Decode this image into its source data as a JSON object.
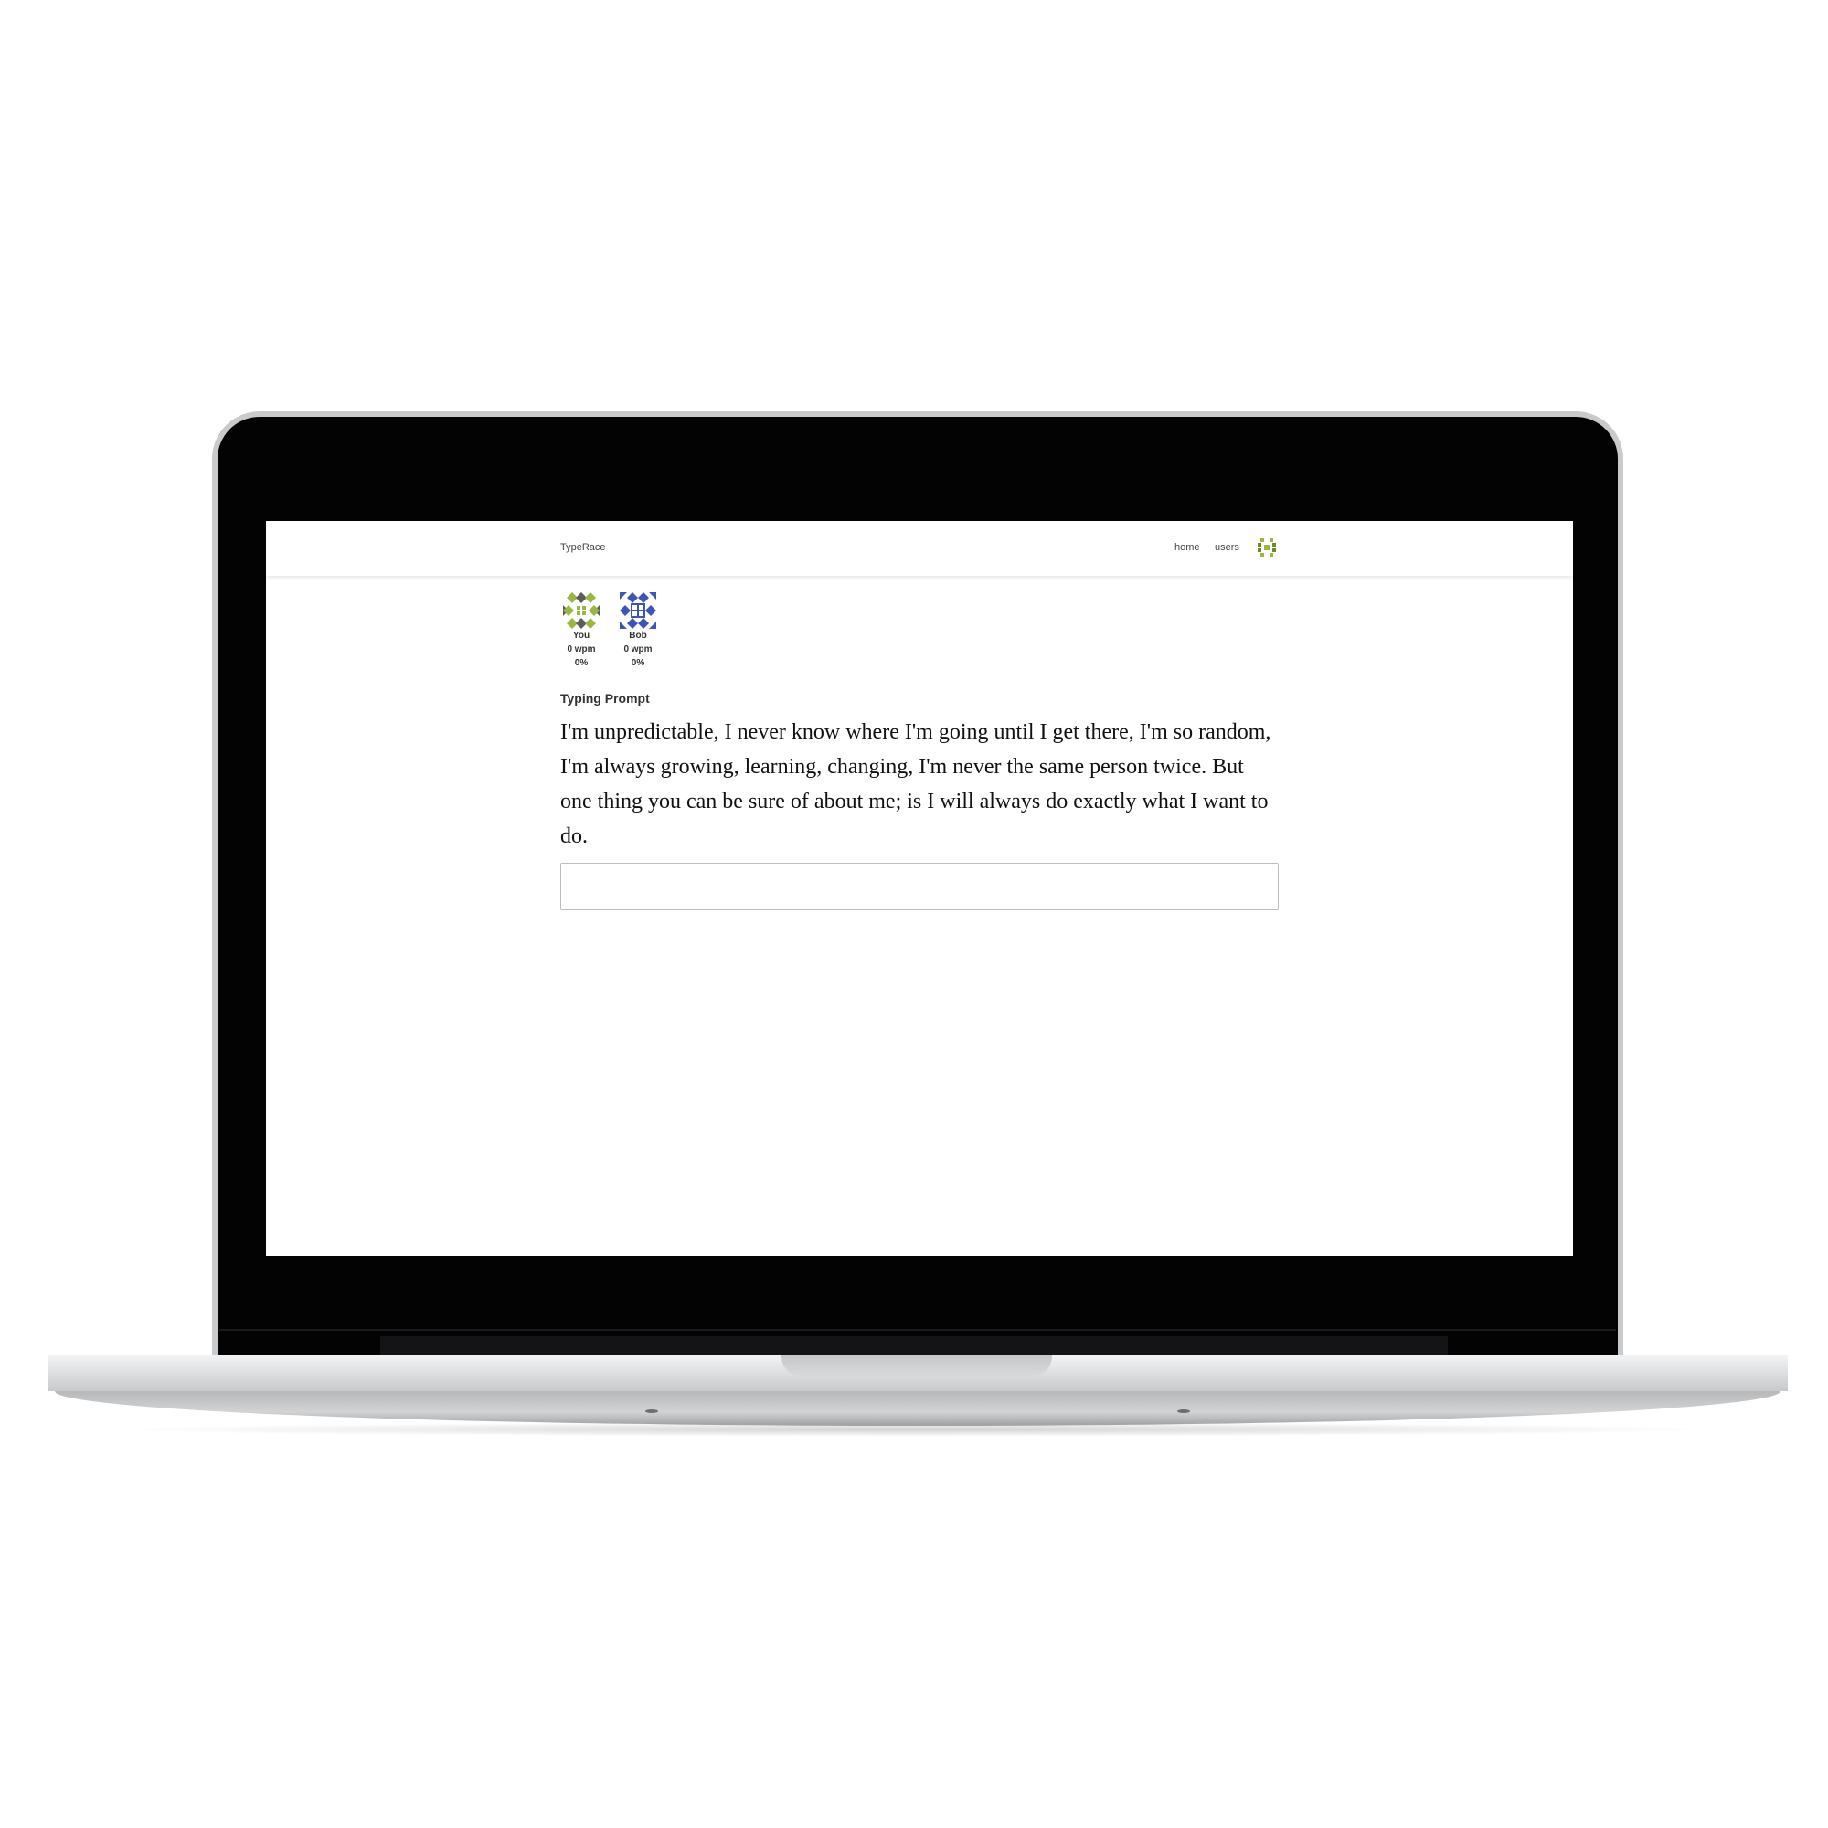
{
  "app": {
    "brand": "TypeRace"
  },
  "nav": {
    "items": [
      {
        "label": "home"
      },
      {
        "label": "users"
      }
    ],
    "avatar_icon": "identicon-avatar-icon"
  },
  "race": {
    "players": [
      {
        "name": "You",
        "wpm": "0 wpm",
        "progress": "0%",
        "avatar_icon": "identicon-green-icon",
        "color": "#9ab83f"
      },
      {
        "name": "Bob",
        "wpm": "0 wpm",
        "progress": "0%",
        "avatar_icon": "identicon-blue-icon",
        "color": "#3e55b8"
      }
    ]
  },
  "prompt": {
    "label": "Typing Prompt",
    "text": "I'm unpredictable, I never know where I'm going until I get there, I'm so random, I'm always growing, learning, changing, I'm never the same person twice. But one thing you can be sure of about me; is I will always do exactly what I want to do."
  },
  "input": {
    "value": "",
    "placeholder": ""
  }
}
